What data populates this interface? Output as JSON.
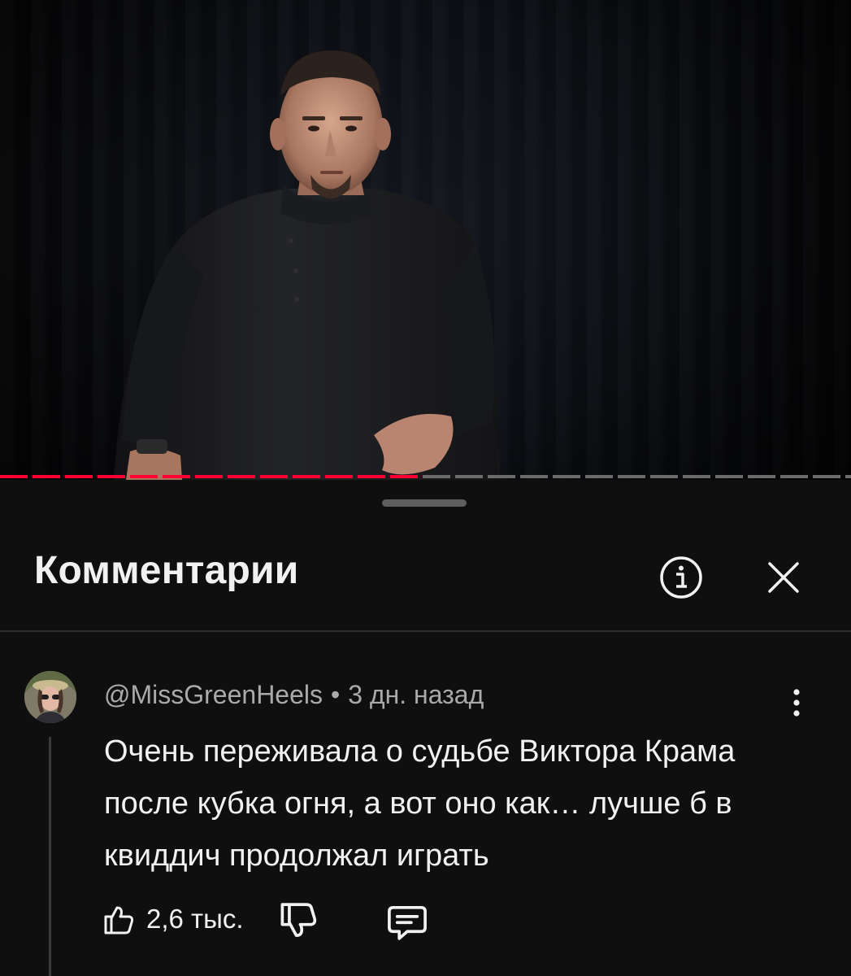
{
  "video": {
    "played_fraction": 0.52
  },
  "sheet": {
    "title": "Комментарии",
    "info_icon": "info-icon",
    "close_icon": "close-icon"
  },
  "comment": {
    "author": "@MissGreenHeels",
    "separator": "•",
    "time": "3 дн. назад",
    "text": "Очень переживала о судьбе Виктора Крама после кубка огня, а вот оно как… лучше б в квиддич продолжал играть",
    "likes": "2,6 тыс."
  },
  "colors": {
    "progress_played": "#ff0033",
    "progress_remaining": "#6b6b6b",
    "background": "#0f0f0f",
    "text_primary": "#f1f1f1",
    "text_secondary": "#aaaaaa"
  }
}
